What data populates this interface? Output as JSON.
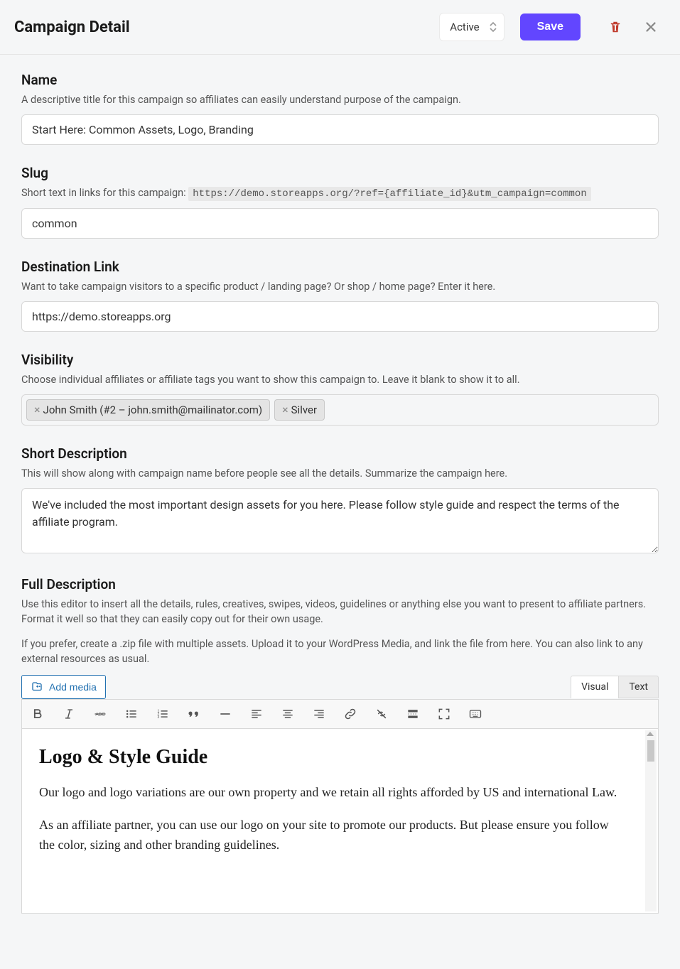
{
  "header": {
    "title": "Campaign Detail",
    "status": "Active",
    "save_label": "Save"
  },
  "fields": {
    "name": {
      "label": "Name",
      "help": "A descriptive title for this campaign so affiliates can easily understand purpose of the campaign.",
      "value": "Start Here: Common Assets, Logo, Branding"
    },
    "slug": {
      "label": "Slug",
      "help_prefix": "Short text in links for this campaign: ",
      "url_example": "https://demo.storeapps.org/?ref={affiliate_id}&utm_campaign=common",
      "value": "common"
    },
    "destination": {
      "label": "Destination Link",
      "help": "Want to take campaign visitors to a specific product / landing page? Or shop / home page? Enter it here.",
      "value": "https://demo.storeapps.org"
    },
    "visibility": {
      "label": "Visibility",
      "help": "Choose individual affiliates or affiliate tags you want to show this campaign to. Leave it blank to show it to all.",
      "tags": [
        "John Smith (#2 – john.smith@mailinator.com)",
        "Silver"
      ]
    },
    "short_desc": {
      "label": "Short Description",
      "help": "This will show along with campaign name before people see all the details. Summarize the campaign here.",
      "value": "We've included the most important design assets for you here. Please follow style guide and respect the terms of the affiliate program."
    },
    "full_desc": {
      "label": "Full Description",
      "help1": "Use this editor to insert all the details, rules, creatives, swipes, videos, guidelines or anything else you want to present to affiliate partners. Format it well so that they can easily copy out for their own usage.",
      "help2": "If you prefer, create a .zip file with multiple assets. Upload it to your WordPress Media, and link the file from here. You can also link to any external resources as usual.",
      "add_media_label": "Add media",
      "tab_visual": "Visual",
      "tab_text": "Text",
      "content_heading": "Logo & Style Guide",
      "content_p1": "Our logo and logo variations are our own property and we retain all rights afforded by US and international Law.",
      "content_p2": "As an affiliate partner, you can use our logo on your site to promote our products. But please ensure you follow the color, sizing and other branding guidelines."
    }
  }
}
